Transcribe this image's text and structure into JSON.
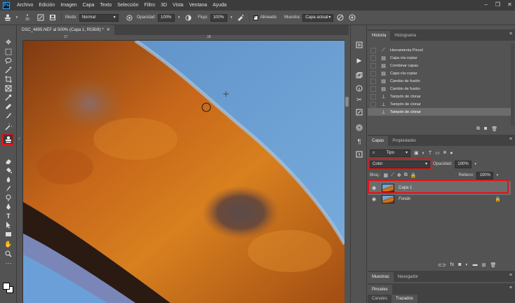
{
  "menubar": {
    "logo": "Ps",
    "items": [
      "Archivo",
      "Edición",
      "Imagen",
      "Capa",
      "Texto",
      "Selección",
      "Filtro",
      "3D",
      "Vista",
      "Ventana",
      "Ayuda"
    ]
  },
  "options": {
    "brush_size": "25",
    "mode_label": "Modo:",
    "mode_value": "Normal",
    "opacity_label": "Opacidad:",
    "opacity_value": "100%",
    "flow_label": "Flujo:",
    "flow_value": "100%",
    "aligned_label": "Alineado",
    "sample_label": "Muestra:",
    "sample_value": "Capa actual"
  },
  "document": {
    "tab_title": "DSC_4895.NEF al 500% (Capa 1, RGB/8) *",
    "ruler_h": [
      "37",
      "38"
    ],
    "ruler_v": [
      "7"
    ]
  },
  "history": {
    "tabs": [
      "Historia",
      "Histograma"
    ],
    "items": [
      {
        "icon": "brush-icon",
        "label": "Herramienta Pincel"
      },
      {
        "icon": "doc-icon",
        "label": "Capa vía copiar"
      },
      {
        "icon": "doc-icon",
        "label": "Combinar capas"
      },
      {
        "icon": "doc-icon",
        "label": "Capa vía copiar"
      },
      {
        "icon": "doc-icon",
        "label": "Cambio de fusión"
      },
      {
        "icon": "doc-icon",
        "label": "Cambio de fusión"
      },
      {
        "icon": "stamp-icon",
        "label": "Tampón de clonar"
      },
      {
        "icon": "stamp-icon",
        "label": "Tampón de clonar"
      },
      {
        "icon": "stamp-icon",
        "label": "Tampón de clonar"
      }
    ]
  },
  "layers": {
    "tabs": [
      "Capas",
      "Propiedades"
    ],
    "filter_label": "Tipo",
    "blend_mode": "Color",
    "opacity_label": "Opacidad:",
    "opacity_value": "100%",
    "lock_label": "Bloq.:",
    "fill_label": "Relleno:",
    "fill_value": "100%",
    "items": [
      {
        "name": "Capa 1",
        "italic": false,
        "locked": false
      },
      {
        "name": "Fondo",
        "italic": true,
        "locked": true
      }
    ]
  },
  "bottom_panels": {
    "tabs1": [
      "Muestras",
      "Navegador"
    ],
    "tabs2": [
      "Pinceles"
    ],
    "tabs3": [
      "Canales",
      "Trazados"
    ]
  },
  "colors": {
    "highlight": "#e0141a",
    "accent": "#31a8ff"
  }
}
